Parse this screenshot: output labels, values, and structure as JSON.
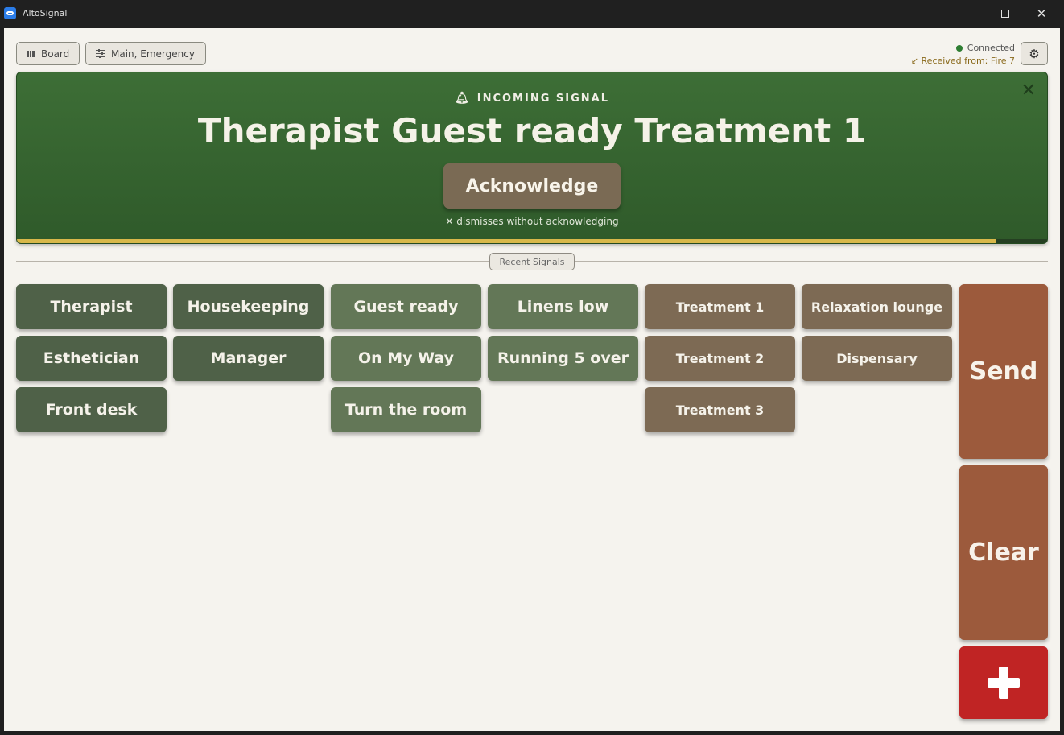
{
  "window": {
    "title": "AltoSignal"
  },
  "toolbar": {
    "board_label": "Board",
    "channels_label": "Main, Emergency"
  },
  "status": {
    "connection": "Connected",
    "received": "↙ Received from: Fire 7",
    "connection_color": "#2e7d32"
  },
  "banner": {
    "label": "INCOMING SIGNAL",
    "message": "Therapist Guest ready Treatment 1",
    "acknowledge_label": "Acknowledge",
    "hint": "✕ dismisses without acknowledging",
    "progress": 0.95,
    "background_color": "#3d6e36",
    "progress_color": "#d8b84a"
  },
  "recent_signals_label": "Recent Signals",
  "signals": {
    "who": [
      "Therapist",
      "Housekeeping",
      "Esthetician",
      "Manager",
      "Front desk"
    ],
    "what": [
      "Guest ready",
      "Linens low",
      "On My Way",
      "Running 5 over",
      "Turn the room"
    ],
    "where": [
      "Treatment 1",
      "Relaxation lounge",
      "Treatment 2",
      "Dispensary",
      "Treatment 3"
    ]
  },
  "actions": {
    "send_label": "Send",
    "clear_label": "Clear",
    "emergency_color": "#c02424"
  },
  "icons": [
    "board-icon",
    "sliders-icon",
    "gear-icon",
    "bell-icon",
    "close-icon",
    "cross-icon"
  ]
}
